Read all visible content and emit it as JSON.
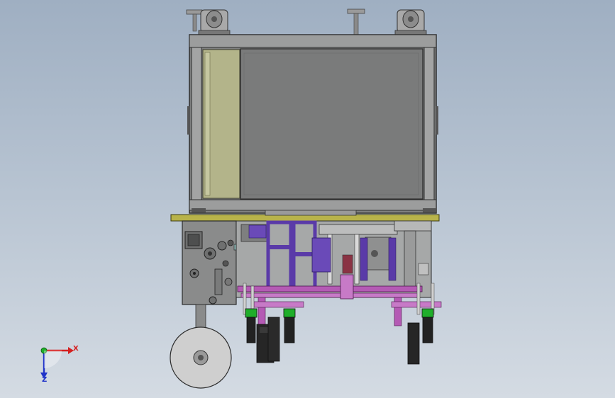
{
  "triad": {
    "x_label": "X",
    "z_label": "Z",
    "colors": {
      "x": "#d42020",
      "y": "#1fae2a",
      "z": "#2033c8"
    }
  },
  "palette": {
    "background_top": "#9fafc2",
    "background_bottom": "#d4dbe3",
    "steel_gray": "#7f8080",
    "panel_olive": "#b3b48a",
    "plate_yellow": "#b8b34a",
    "bracket_purple": "#5a3aa8",
    "frame_magenta": "#b45ab4",
    "wheel_light": "#cfcfcf"
  }
}
